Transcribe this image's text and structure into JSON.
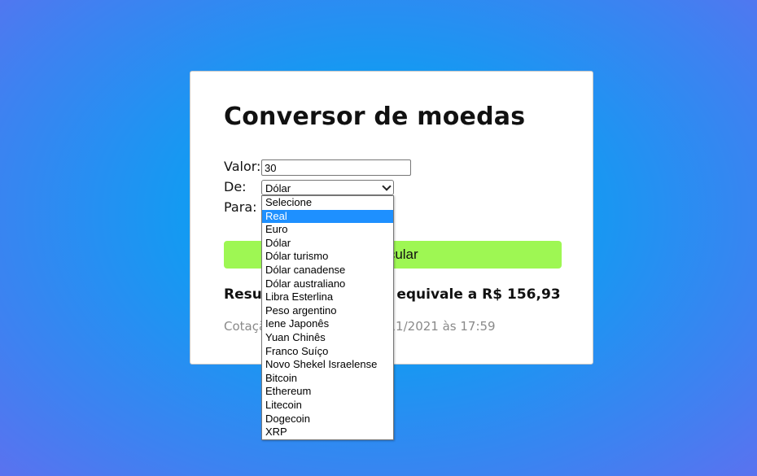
{
  "card": {
    "title": "Conversor de moedas",
    "valor_label": "Valor:",
    "valor_value": "30",
    "de_label": "De:",
    "de_selected": "Dólar",
    "para_label": "Para:",
    "button_label": "Calcular",
    "result_text": "Resultado: US$ 30,00 equivale a R$ 156,93",
    "cotacao_text": "Cotação atualizada em 05/11/2021 às 17:59"
  },
  "dropdown": {
    "highlighted": "Real",
    "options": [
      "Selecione",
      "Real",
      "Euro",
      "Dólar",
      "Dólar turismo",
      "Dólar canadense",
      "Dólar australiano",
      "Libra Esterlina",
      "Peso argentino",
      "Iene Japonês",
      "Yuan Chinês",
      "Franco Suíço",
      "Novo Shekel Israelense",
      "Bitcoin",
      "Ethereum",
      "Litecoin",
      "Dogecoin",
      "XRP"
    ]
  },
  "colors": {
    "button": "#9ef753",
    "highlight": "#1e90ff",
    "background": "#08a6f3"
  }
}
